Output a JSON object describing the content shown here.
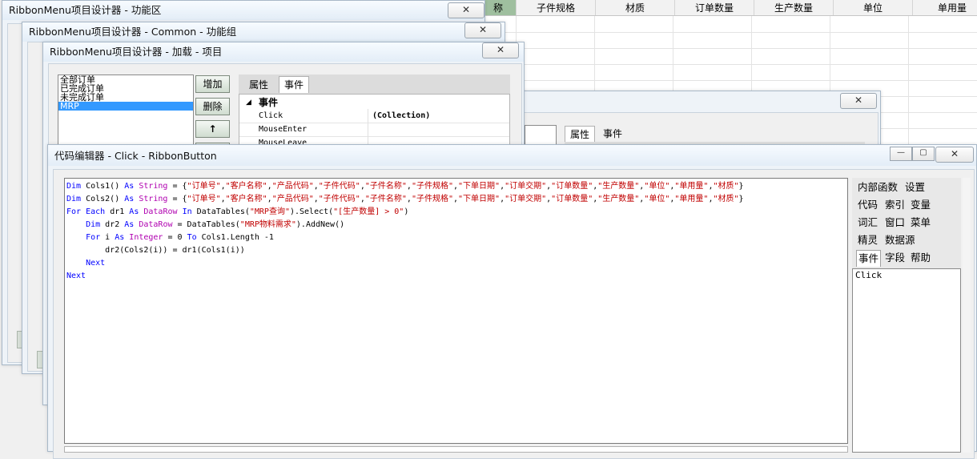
{
  "spreadsheet": {
    "headers": [
      "称",
      "子件规格",
      "材质",
      "订单数量",
      "生产数量",
      "单位",
      "单用量"
    ]
  },
  "window_ribbon": {
    "title": "RibbonMenu项目设计器 - 功能区",
    "close_glyph": "✕"
  },
  "window_common": {
    "title": "RibbonMenu项目设计器 - Common - 功能组",
    "close_glyph": "✕"
  },
  "window_load": {
    "title": "RibbonMenu项目设计器 - 加载 - 项目",
    "close_glyph": "✕",
    "items": [
      "全部订单",
      "已完成订单",
      "未完成订单",
      "MRP"
    ],
    "buttons": {
      "add": "增加",
      "delete": "删除",
      "up": "↑"
    },
    "tabs": [
      "属性",
      "事件"
    ],
    "events_header": "事件",
    "events": [
      {
        "name": "Click",
        "value": "(Collection)"
      },
      {
        "name": "MouseEnter",
        "value": ""
      },
      {
        "name": "MouseLeave",
        "value": ""
      }
    ]
  },
  "window_back": {
    "close_glyph": "✕",
    "tabs": [
      "属性",
      "事件"
    ]
  },
  "code_editor": {
    "title": "代码编辑器 - Click - RibbonButton",
    "minimize_glyph": "—",
    "maximize_glyph": "▢",
    "close_glyph": "✕",
    "code_lines": [
      "Dim Cols1() As String = {\"订单号\",\"客户名称\",\"产品代码\",\"子件代码\",\"子件名称\",\"子件规格\",\"下单日期\",\"订单交期\",\"订单数量\",\"生产数量\",\"单位\",\"单用量\",\"材质\"}",
      "Dim Cols2() As String = {\"订单号\",\"客户名称\",\"产品代码\",\"子件代码\",\"子件名称\",\"子件规格\",\"下单日期\",\"订单交期\",\"订单数量\",\"生产数量\",\"单位\",\"单用量\",\"材质\"}",
      "For Each dr1 As DataRow In DataTables(\"MRP查询\").Select(\"[生产数量] > 0\")",
      "    Dim dr2 As DataRow = DataTables(\"MRP物料需求\").AddNew()",
      "    For i As Integer = 0 To Cols1.Length -1",
      "        dr2(Cols2(i)) = dr1(Cols1(i))",
      "    Next",
      "Next"
    ],
    "side_tabs": [
      [
        "内部函数",
        "设置"
      ],
      [
        "代码",
        "索引",
        "变量"
      ],
      [
        "词汇",
        "窗口",
        "菜单"
      ],
      [
        "精灵",
        "数据源"
      ],
      [
        "事件",
        "字段",
        "帮助"
      ]
    ],
    "active_side_tab": "事件",
    "side_list_items": [
      "Click"
    ]
  }
}
